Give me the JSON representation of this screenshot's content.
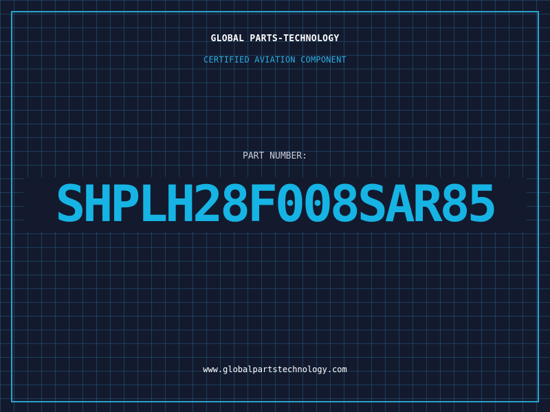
{
  "header": {
    "company": "GLOBAL PARTS-TECHNOLOGY",
    "tagline": "CERTIFIED AVIATION COMPONENT"
  },
  "part": {
    "label": "PART NUMBER:",
    "number": "SHPLH28F008SAR85"
  },
  "footer": {
    "website": "www.globalpartstechnology.com"
  },
  "colors": {
    "background": "#131a2e",
    "grid": "#286e91",
    "accent": "#16b4e4",
    "frame": "#2aa4cf"
  }
}
